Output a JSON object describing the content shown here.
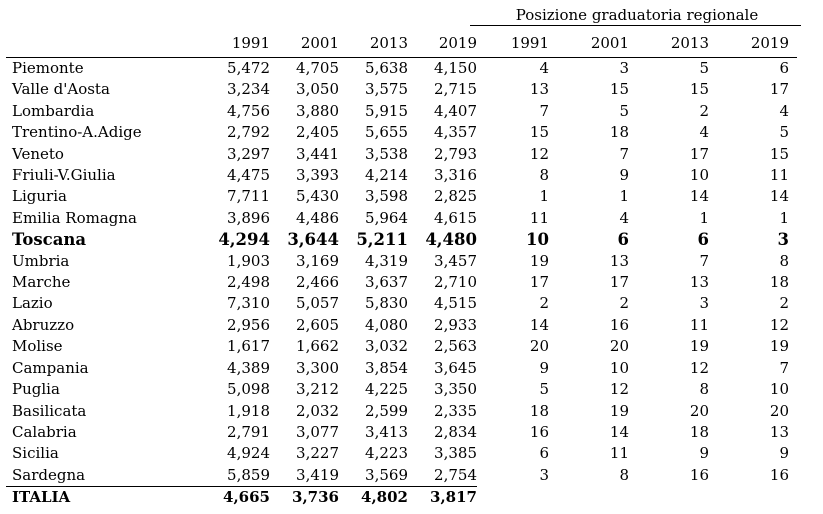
{
  "group_header": "Posizione graduatoria regionale",
  "years": [
    "1991",
    "2001",
    "2013",
    "2019"
  ],
  "rank_years": [
    "1991",
    "2001",
    "2013",
    "2019"
  ],
  "rows": [
    {
      "region": "Piemonte",
      "v": [
        "5,472",
        "4,705",
        "5,638",
        "4,150"
      ],
      "r": [
        "4",
        "3",
        "5",
        "6"
      ]
    },
    {
      "region": "Valle d'Aosta",
      "v": [
        "3,234",
        "3,050",
        "3,575",
        "2,715"
      ],
      "r": [
        "13",
        "15",
        "15",
        "17"
      ]
    },
    {
      "region": "Lombardia",
      "v": [
        "4,756",
        "3,880",
        "5,915",
        "4,407"
      ],
      "r": [
        "7",
        "5",
        "2",
        "4"
      ]
    },
    {
      "region": "Trentino-A.Adige",
      "v": [
        "2,792",
        "2,405",
        "5,655",
        "4,357"
      ],
      "r": [
        "15",
        "18",
        "4",
        "5"
      ]
    },
    {
      "region": "Veneto",
      "v": [
        "3,297",
        "3,441",
        "3,538",
        "2,793"
      ],
      "r": [
        "12",
        "7",
        "17",
        "15"
      ]
    },
    {
      "region": "Friuli-V.Giulia",
      "v": [
        "4,475",
        "3,393",
        "4,214",
        "3,316"
      ],
      "r": [
        "8",
        "9",
        "10",
        "11"
      ]
    },
    {
      "region": "Liguria",
      "v": [
        "7,711",
        "5,430",
        "3,598",
        "2,825"
      ],
      "r": [
        "1",
        "1",
        "14",
        "14"
      ]
    },
    {
      "region": "Emilia Romagna",
      "v": [
        "3,896",
        "4,486",
        "5,964",
        "4,615"
      ],
      "r": [
        "11",
        "4",
        "1",
        "1"
      ]
    },
    {
      "region": "Toscana",
      "v": [
        "4,294",
        "3,644",
        "5,211",
        "4,480"
      ],
      "r": [
        "10",
        "6",
        "6",
        "3"
      ],
      "bold": true
    },
    {
      "region": "Umbria",
      "v": [
        "1,903",
        "3,169",
        "4,319",
        "3,457"
      ],
      "r": [
        "19",
        "13",
        "7",
        "8"
      ]
    },
    {
      "region": "Marche",
      "v": [
        "2,498",
        "2,466",
        "3,637",
        "2,710"
      ],
      "r": [
        "17",
        "17",
        "13",
        "18"
      ]
    },
    {
      "region": "Lazio",
      "v": [
        "7,310",
        "5,057",
        "5,830",
        "4,515"
      ],
      "r": [
        "2",
        "2",
        "3",
        "2"
      ]
    },
    {
      "region": "Abruzzo",
      "v": [
        "2,956",
        "2,605",
        "4,080",
        "2,933"
      ],
      "r": [
        "14",
        "16",
        "11",
        "12"
      ]
    },
    {
      "region": "Molise",
      "v": [
        "1,617",
        "1,662",
        "3,032",
        "2,563"
      ],
      "r": [
        "20",
        "20",
        "19",
        "19"
      ]
    },
    {
      "region": "Campania",
      "v": [
        "4,389",
        "3,300",
        "3,854",
        "3,645"
      ],
      "r": [
        "9",
        "10",
        "12",
        "7"
      ]
    },
    {
      "region": "Puglia",
      "v": [
        "5,098",
        "3,212",
        "4,225",
        "3,350"
      ],
      "r": [
        "5",
        "12",
        "8",
        "10"
      ]
    },
    {
      "region": "Basilicata",
      "v": [
        "1,918",
        "2,032",
        "2,599",
        "2,335"
      ],
      "r": [
        "18",
        "19",
        "20",
        "20"
      ]
    },
    {
      "region": "Calabria",
      "v": [
        "2,791",
        "3,077",
        "3,413",
        "2,834"
      ],
      "r": [
        "16",
        "14",
        "18",
        "13"
      ]
    },
    {
      "region": "Sicilia",
      "v": [
        "4,924",
        "3,227",
        "4,223",
        "3,385"
      ],
      "r": [
        "6",
        "11",
        "9",
        "9"
      ]
    },
    {
      "region": "Sardegna",
      "v": [
        "5,859",
        "3,419",
        "3,569",
        "2,754"
      ],
      "r": [
        "3",
        "8",
        "16",
        "16"
      ]
    }
  ],
  "total": {
    "region": "ITALIA",
    "v": [
      "4,665",
      "3,736",
      "4,802",
      "3,817"
    ]
  }
}
